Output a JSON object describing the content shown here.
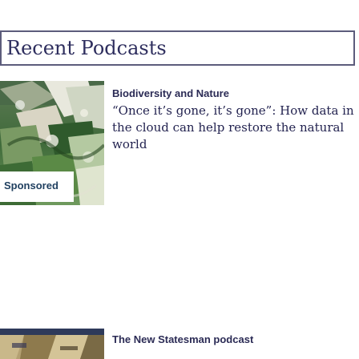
{
  "header": {
    "title": "Recent Podcasts"
  },
  "podcasts": [
    {
      "kicker": "Biodiversity and Nature",
      "headline": "“Once it’s gone, it’s gone”: How data in the cloud can help restore the natural world",
      "badge": "Sponsored",
      "thumbnail_icon": "nature-photo-thumbnail"
    },
    {
      "kicker": "The New Statesman podcast",
      "thumbnail_icon": "podcast-thumbnail"
    }
  ],
  "colors": {
    "border": "#5c5c7c",
    "title": "#2e2e5e",
    "text": "#232350"
  }
}
